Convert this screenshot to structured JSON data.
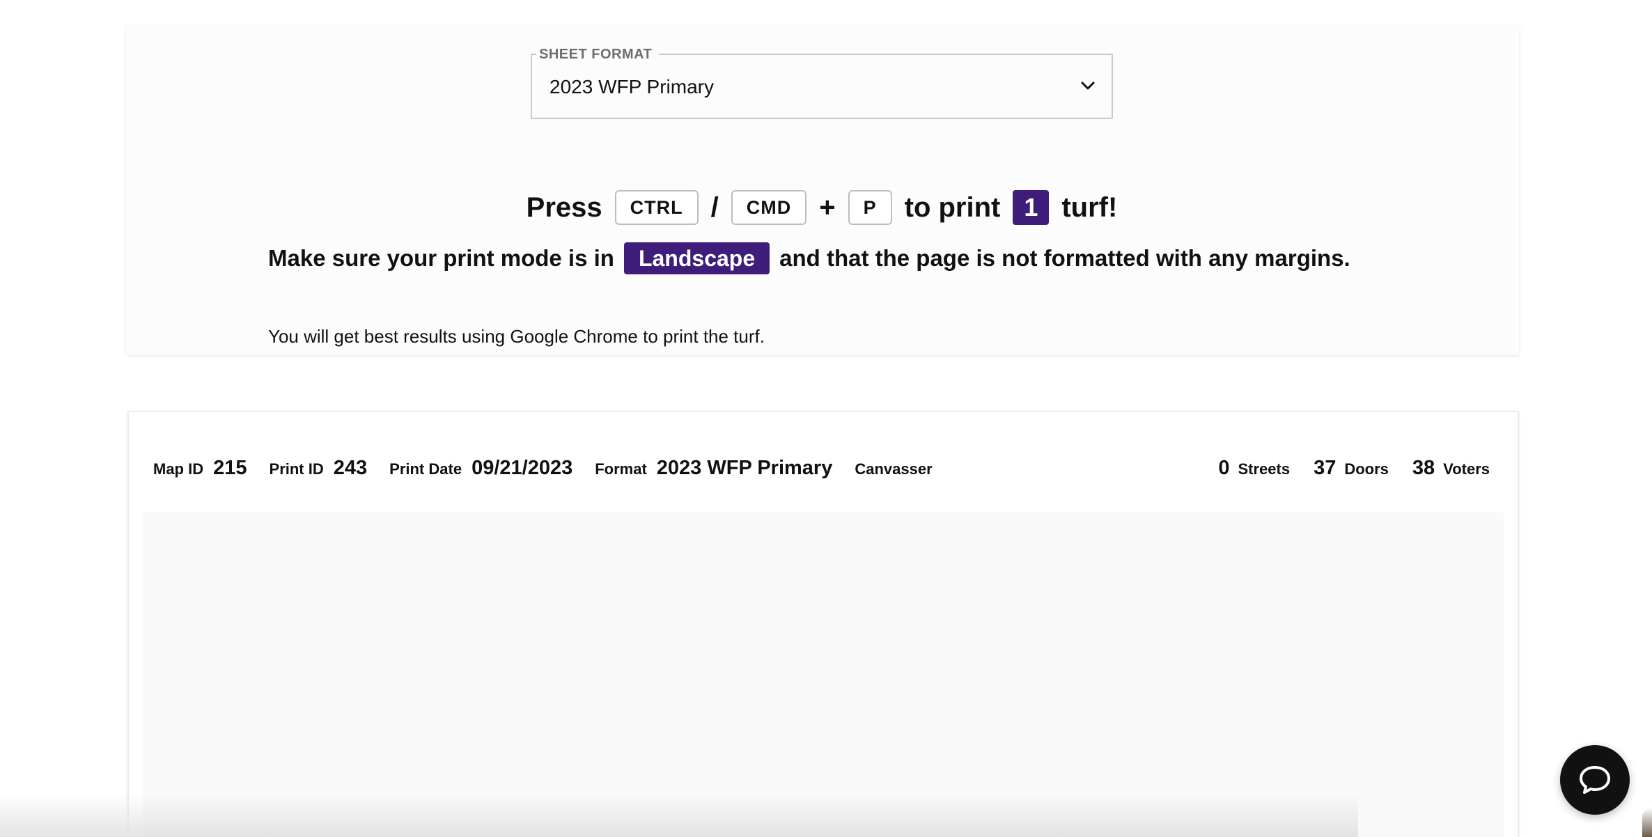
{
  "sheet_format": {
    "legend": "SHEET FORMAT",
    "selected": "2023 WFP Primary"
  },
  "print_instructions": {
    "press": "Press",
    "key_ctrl": "CTRL",
    "slash": "/",
    "key_cmd": "CMD",
    "plus": "+",
    "key_p": "P",
    "to_print": "to print",
    "turf_count": "1",
    "turf_suffix": "turf!",
    "mode_prefix": "Make sure your print mode is in",
    "mode_value": "Landscape",
    "mode_suffix": "and that the page is not formatted with any margins.",
    "browser_note": "You will get best results using Google Chrome to print the turf."
  },
  "sheet": {
    "map_id_label": "Map ID",
    "map_id": "215",
    "print_id_label": "Print ID",
    "print_id": "243",
    "print_date_label": "Print Date",
    "print_date": "09/21/2023",
    "format_label": "Format",
    "format": "2023 WFP Primary",
    "canvasser_label": "Canvasser",
    "streets": "0",
    "streets_label": "Streets",
    "doors": "37",
    "doors_label": "Doors",
    "voters": "38",
    "voters_label": "Voters"
  },
  "icons": {
    "dropdown": "chevron-down-icon",
    "chat": "chat-bubble-icon"
  },
  "colors": {
    "accent": "#3f1d7a",
    "chat_button": "#111111"
  }
}
